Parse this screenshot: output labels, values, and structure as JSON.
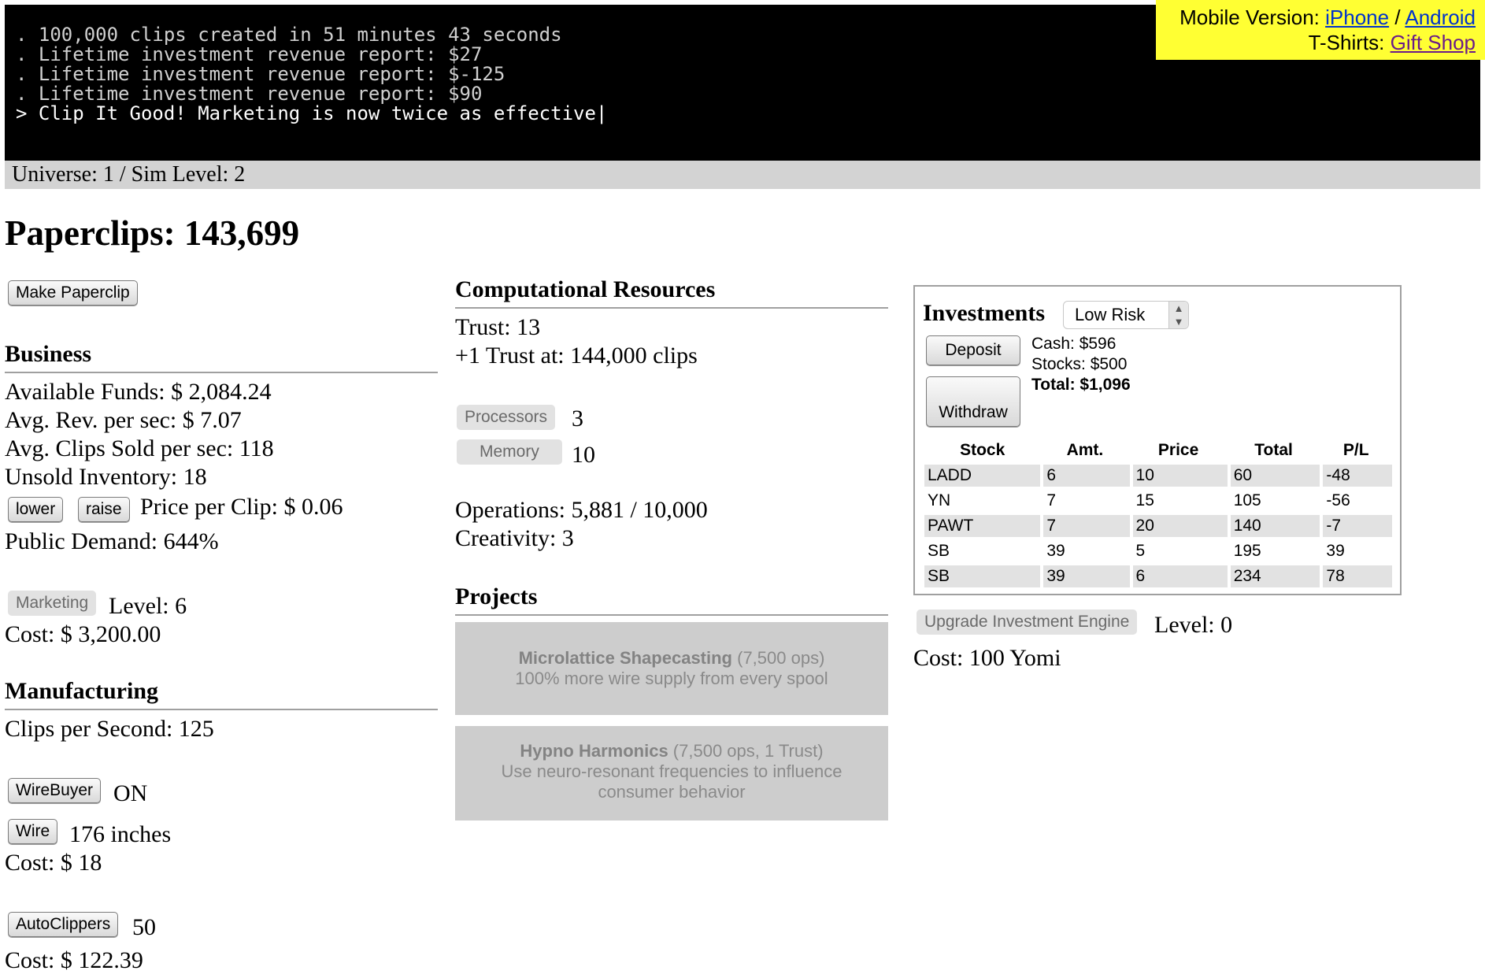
{
  "console": {
    "lines": [
      ". 100,000 clips created in 51 minutes 43 seconds",
      ". Lifetime investment revenue report: $27",
      ". Lifetime investment revenue report: $-125",
      ". Lifetime investment revenue report: $90",
      "> Clip It Good! Marketing is now twice as effective|"
    ]
  },
  "promo": {
    "mobile_label": "Mobile Version:",
    "iphone": "iPhone",
    "separator": "/",
    "android": "Android",
    "tshirts_label": "T-Shirts:",
    "gift_shop": "Gift Shop"
  },
  "status": "Universe: 1 / Sim Level: 2",
  "paperclips": "Paperclips: 143,699",
  "make_button": "Make Paperclip",
  "business": {
    "heading": "Business",
    "funds": "Available Funds: $ 2,084.24",
    "rev": "Avg. Rev. per sec: $ 7.07",
    "sold": "Avg. Clips Sold per sec: 118",
    "unsold": "Unsold Inventory: 18",
    "lower": "lower",
    "raise": "raise",
    "price": "Price per Clip: $ 0.06",
    "demand": "Public Demand: 644%",
    "marketing_button": "Marketing",
    "marketing_level": "Level: 6",
    "marketing_cost": "Cost: $ 3,200.00"
  },
  "manufacturing": {
    "heading": "Manufacturing",
    "cps": "Clips per Second: 125",
    "wirebuyer_button": "WireBuyer",
    "wirebuyer_state": "ON",
    "wire_button": "Wire",
    "wire_amount": "176 inches",
    "wire_cost": "Cost: $ 18",
    "autoclippers_button": "AutoClippers",
    "autoclippers_count": "50",
    "autoclippers_cost": "Cost: $ 122.39"
  },
  "compute": {
    "heading": "Computational Resources",
    "trust": "Trust: 13",
    "next_trust": "+1 Trust at: 144,000 clips",
    "processors_button": "Processors",
    "processors_value": "3",
    "memory_button": "Memory",
    "memory_value": "10",
    "operations": "Operations: 5,881 / 10,000",
    "creativity": "Creativity: 3"
  },
  "projects": {
    "heading": "Projects",
    "items": [
      {
        "title": "Microlattice Shapecasting",
        "cost": " (7,500 ops)",
        "desc": "100% more wire supply from every spool"
      },
      {
        "title": "Hypno Harmonics",
        "cost": " (7,500 ops, 1 Trust)",
        "desc": "Use neuro-resonant frequencies to influence consumer behavior"
      }
    ]
  },
  "investments": {
    "heading": "Investments",
    "risk": "Low Risk",
    "deposit": "Deposit",
    "withdraw": "Withdraw",
    "cash": "Cash: $596",
    "stocks": "Stocks: $500",
    "total": "Total: $1,096",
    "columns": [
      "Stock",
      "Amt.",
      "Price",
      "Total",
      "P/L"
    ],
    "rows": [
      [
        "LADD",
        "6",
        "10",
        "60",
        "-48"
      ],
      [
        "YN",
        "7",
        "15",
        "105",
        "-56"
      ],
      [
        "PAWT",
        "7",
        "20",
        "140",
        "-7"
      ],
      [
        "SB",
        "39",
        "5",
        "195",
        "39"
      ],
      [
        "SB",
        "39",
        "6",
        "234",
        "78"
      ]
    ],
    "upgrade_button": "Upgrade Investment Engine",
    "upgrade_level": "Level: 0",
    "upgrade_cost": "Cost: 100 Yomi"
  }
}
